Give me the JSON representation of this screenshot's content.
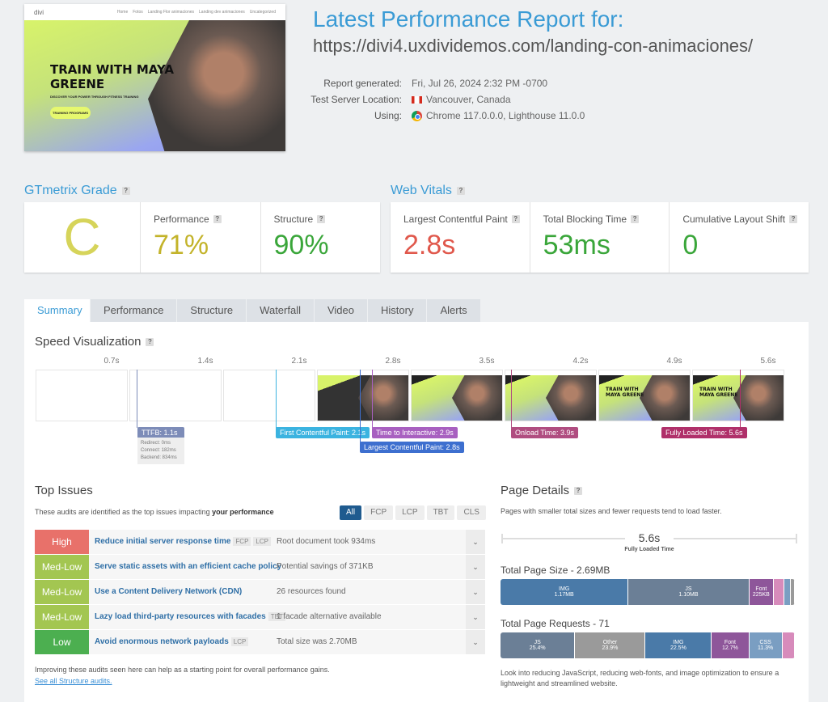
{
  "screenshot": {
    "nav_items": [
      "Home",
      "Fotos",
      "Landing Flor animaciones",
      "Landing dev animaciones",
      "Uncategorized"
    ],
    "logo": "divi",
    "headline": "TRAIN WITH MAYA GREENE",
    "subline": "DISCOVER YOUR POWER THROUGH FITNESS TRAINING",
    "button": "TRAINING PROGRAMS"
  },
  "header": {
    "title": "Latest Performance Report for:",
    "url_text": "https://divi4.uxdividemos.com/landing-con-animaciones/"
  },
  "meta": [
    {
      "label": "Report generated:",
      "value": "Fri, Jul 26, 2024 2:32 PM -0700",
      "icon": ""
    },
    {
      "label": "Test Server Location:",
      "value": "Vancouver, Canada",
      "icon": "canada-flag-icon"
    },
    {
      "label": "Using:",
      "value": "Chrome 117.0.0.0, Lighthouse 11.0.0",
      "icon": "chrome-icon"
    }
  ],
  "grade": {
    "heading": "GTmetrix Grade",
    "letter": "C",
    "performance_label": "Performance",
    "performance": "71%",
    "structure_label": "Structure",
    "structure": "90%"
  },
  "vitals": {
    "heading": "Web Vitals",
    "items": [
      {
        "label": "Largest Contentful Paint",
        "value": "2.8s",
        "color": "#e0584c"
      },
      {
        "label": "Total Blocking Time",
        "value": "53ms",
        "color": "#3aa63a"
      },
      {
        "label": "Cumulative Layout Shift",
        "value": "0",
        "color": "#3aa63a"
      }
    ]
  },
  "tabs": [
    "Summary",
    "Performance",
    "Structure",
    "Waterfall",
    "Video",
    "History",
    "Alerts"
  ],
  "speed": {
    "heading": "Speed Visualization",
    "times": [
      "0.7s",
      "1.4s",
      "2.1s",
      "2.8s",
      "3.5s",
      "4.2s",
      "4.9s",
      "5.6s"
    ],
    "ttfb": {
      "label": "TTFB: 1.1s",
      "redirect": "Redirect: 0ms",
      "connect": "Connect: 182ms",
      "backend": "Backend: 834ms"
    },
    "markers": {
      "fcp": "First Contentful Paint: 2.1s",
      "tti": "Time to Interactive: 2.9s",
      "lcp": "Largest Contentful Paint: 2.8s",
      "onload": "Onload Time: 3.9s",
      "fully": "Fully Loaded Time: 5.6s"
    }
  },
  "issues": {
    "heading": "Top Issues",
    "intro": "These audits are identified as the top issues impacting ",
    "intro_bold": "your performance",
    "filters": [
      "All",
      "FCP",
      "LCP",
      "TBT",
      "CLS"
    ],
    "rows": [
      {
        "severity": "High",
        "color": "#e8716a",
        "title": "Reduce initial server response time",
        "tags": [
          "FCP",
          "LCP"
        ],
        "desc": "Root document took 934ms"
      },
      {
        "severity": "Med-Low",
        "color": "#a3c651",
        "title": "Serve static assets with an efficient cache policy",
        "tags": [],
        "desc": "Potential savings of 371KB"
      },
      {
        "severity": "Med-Low",
        "color": "#a3c651",
        "title": "Use a Content Delivery Network (CDN)",
        "tags": [],
        "desc": "26 resources found"
      },
      {
        "severity": "Med-Low",
        "color": "#a3c651",
        "title": "Lazy load third-party resources with facades",
        "tags": [
          "TBT"
        ],
        "desc": "1 facade alternative available"
      },
      {
        "severity": "Low",
        "color": "#4caf50",
        "title": "Avoid enormous network payloads",
        "tags": [
          "LCP"
        ],
        "desc": "Total size was 2.70MB"
      }
    ],
    "footer": "Improving these audits seen here can help as a starting point for overall performance gains.",
    "link": "See all Structure audits."
  },
  "details": {
    "heading": "Page Details",
    "intro": "Pages with smaller total sizes and fewer requests tend to load faster.",
    "fully_loaded": "5.6s",
    "fully_loaded_label": "Fully Loaded Time",
    "size_title": "Total Page Size - 2.69MB",
    "size": [
      {
        "label": "IMG",
        "value": "1.17MB",
        "pct": 43.5,
        "color": "#4a7aa8"
      },
      {
        "label": "JS",
        "value": "1.10MB",
        "pct": 41,
        "color": "#6b7f96"
      },
      {
        "label": "Font",
        "value": "225KB",
        "pct": 8.4,
        "color": "#8e569a"
      },
      {
        "label": "",
        "value": "",
        "pct": 3.4,
        "color": "#d78bbb"
      },
      {
        "label": "",
        "value": "",
        "pct": 2.2,
        "color": "#7a9ec2"
      },
      {
        "label": "",
        "value": "",
        "pct": 1.5,
        "color": "#9a9a9a"
      }
    ],
    "req_title": "Total Page Requests - 71",
    "requests": [
      {
        "label": "JS",
        "value": "25.4%",
        "pct": 25.4,
        "color": "#6b7f96"
      },
      {
        "label": "Other",
        "value": "23.9%",
        "pct": 23.9,
        "color": "#9a9a9a"
      },
      {
        "label": "IMG",
        "value": "22.5%",
        "pct": 22.5,
        "color": "#4a7aa8"
      },
      {
        "label": "Font",
        "value": "12.7%",
        "pct": 12.7,
        "color": "#8e569a"
      },
      {
        "label": "CSS",
        "value": "11.3%",
        "pct": 11.3,
        "color": "#7a9ec2"
      },
      {
        "label": "",
        "value": "",
        "pct": 4.2,
        "color": "#d78bbb"
      }
    ],
    "note": "Look into reducing JavaScript, reducing web-fonts, and image optimization to ensure a lightweight and streamlined website."
  }
}
